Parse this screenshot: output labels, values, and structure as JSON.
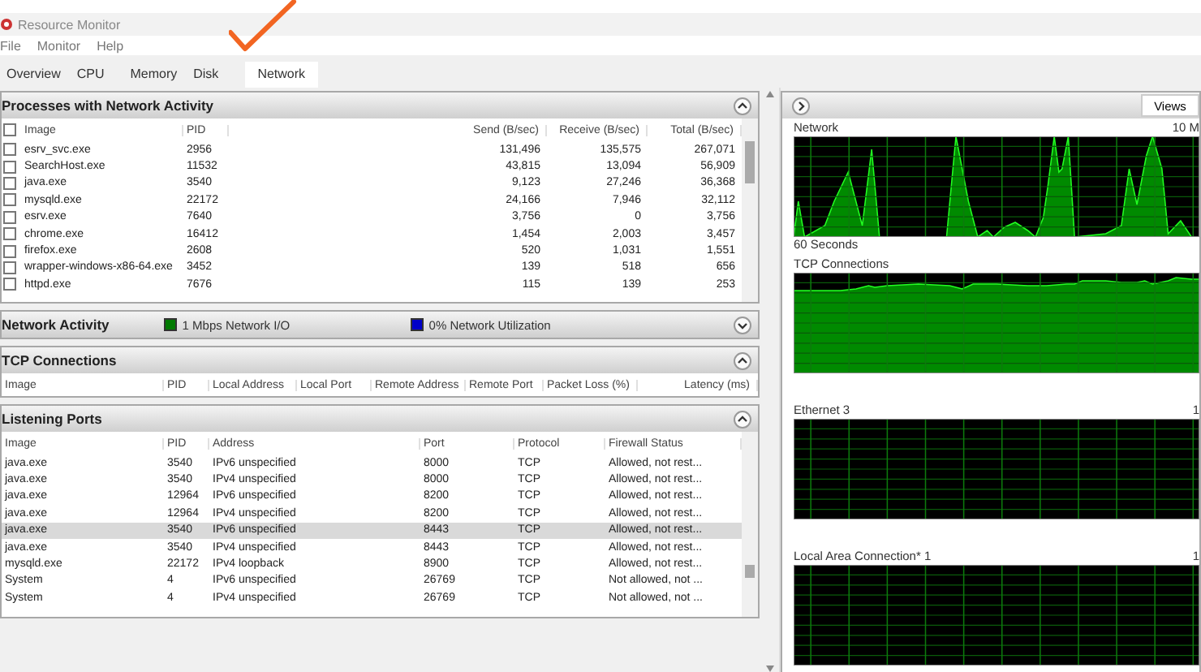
{
  "window": {
    "title": "Resource Monitor"
  },
  "menu": [
    "File",
    "Monitor",
    "Help"
  ],
  "tabs": [
    {
      "label": "Overview",
      "selected": false
    },
    {
      "label": "CPU",
      "selected": false
    },
    {
      "label": "Memory",
      "selected": false
    },
    {
      "label": "Disk",
      "selected": false
    },
    {
      "label": "Network",
      "selected": true
    }
  ],
  "sections": [
    {
      "kind": "processes",
      "title": "Processes with Network Activity",
      "expanded": true,
      "all_checked": false,
      "columns": [
        "Image",
        "PID",
        "Send (B/sec)",
        "Receive (B/sec)",
        "Total (B/sec)"
      ],
      "rows": [
        {
          "checked": false,
          "cells": [
            "esrv_svc.exe",
            "2956",
            "131,496",
            "135,575",
            "267,071"
          ]
        },
        {
          "checked": false,
          "cells": [
            "SearchHost.exe",
            "11532",
            "43,815",
            "13,094",
            "56,909"
          ]
        },
        {
          "checked": false,
          "cells": [
            "java.exe",
            "3540",
            "9,123",
            "27,246",
            "36,368"
          ]
        },
        {
          "checked": false,
          "cells": [
            "mysqld.exe",
            "22172",
            "24,166",
            "7,946",
            "32,112"
          ]
        },
        {
          "checked": false,
          "cells": [
            "esrv.exe",
            "7640",
            "3,756",
            "0",
            "3,756"
          ]
        },
        {
          "checked": false,
          "cells": [
            "chrome.exe",
            "16412",
            "1,454",
            "2,003",
            "3,457"
          ]
        },
        {
          "checked": false,
          "cells": [
            "firefox.exe",
            "2608",
            "520",
            "1,031",
            "1,551"
          ]
        },
        {
          "checked": false,
          "cells": [
            "wrapper-windows-x86-64.exe",
            "3452",
            "139",
            "518",
            "656"
          ]
        },
        {
          "checked": false,
          "cells": [
            "httpd.exe",
            "7676",
            "115",
            "139",
            "253"
          ]
        }
      ]
    },
    {
      "kind": "activity",
      "title": "Network Activity",
      "expanded": false,
      "legend": [
        {
          "label": "1 Mbps Network I/O",
          "color": "#007a00"
        },
        {
          "label": "0% Network Utilization",
          "color": "#0000c8"
        }
      ]
    },
    {
      "kind": "connections",
      "title": "TCP Connections",
      "expanded": true,
      "columns": [
        "Image",
        "PID",
        "Local Address",
        "Local Port",
        "Remote Address",
        "Remote Port",
        "Packet Loss (%)",
        "Latency (ms)"
      ]
    },
    {
      "kind": "ports",
      "title": "Listening Ports",
      "expanded": true,
      "columns": [
        "Image",
        "PID",
        "Address",
        "Port",
        "Protocol",
        "Firewall Status"
      ],
      "rows": [
        {
          "selected": false,
          "cells": [
            "java.exe",
            "3540",
            "IPv6 unspecified",
            "8000",
            "TCP",
            "Allowed, not rest..."
          ]
        },
        {
          "selected": false,
          "cells": [
            "java.exe",
            "3540",
            "IPv4 unspecified",
            "8000",
            "TCP",
            "Allowed, not rest..."
          ]
        },
        {
          "selected": false,
          "cells": [
            "java.exe",
            "12964",
            "IPv6 unspecified",
            "8200",
            "TCP",
            "Allowed, not rest..."
          ]
        },
        {
          "selected": false,
          "cells": [
            "java.exe",
            "12964",
            "IPv4 unspecified",
            "8200",
            "TCP",
            "Allowed, not rest..."
          ]
        },
        {
          "selected": true,
          "cells": [
            "java.exe",
            "3540",
            "IPv6 unspecified",
            "8443",
            "TCP",
            "Allowed, not rest..."
          ]
        },
        {
          "selected": false,
          "cells": [
            "java.exe",
            "3540",
            "IPv4 unspecified",
            "8443",
            "TCP",
            "Allowed, not rest..."
          ]
        },
        {
          "selected": false,
          "cells": [
            "mysqld.exe",
            "22172",
            "IPv4 loopback",
            "8900",
            "TCP",
            "Allowed, not rest..."
          ]
        },
        {
          "selected": false,
          "cells": [
            "System",
            "4",
            "IPv6 unspecified",
            "26769",
            "TCP",
            "Not allowed, not ..."
          ]
        },
        {
          "selected": false,
          "cells": [
            "System",
            "4",
            "IPv4 unspecified",
            "26769",
            "TCP",
            "Not allowed, not ..."
          ]
        }
      ]
    }
  ],
  "views_button": "Views",
  "graphs": [
    {
      "kind": "spiky",
      "title": "Network",
      "scale": "10 M",
      "footer": "60 Seconds"
    },
    {
      "kind": "filled",
      "title": "TCP Connections"
    },
    {
      "kind": "flat",
      "title": "Ethernet 3",
      "scale": "1"
    },
    {
      "kind": "flat",
      "title": "Local Area Connection* 1",
      "scale": "1"
    }
  ]
}
